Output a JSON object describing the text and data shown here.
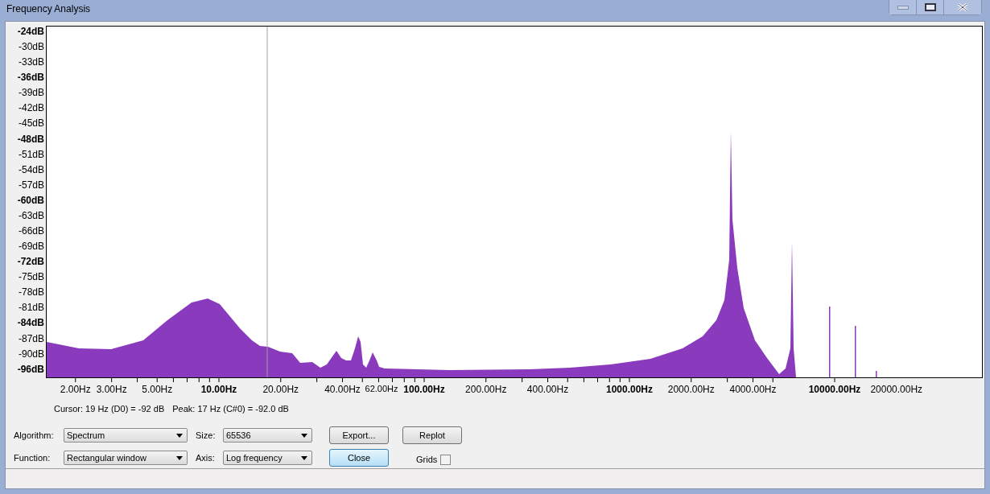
{
  "window": {
    "title": "Frequency Analysis"
  },
  "y_axis": [
    {
      "label": "-24dB",
      "bold": true
    },
    {
      "label": "-30dB",
      "bold": false
    },
    {
      "label": "-33dB",
      "bold": false
    },
    {
      "label": "-36dB",
      "bold": true
    },
    {
      "label": "-39dB",
      "bold": false
    },
    {
      "label": "-42dB",
      "bold": false
    },
    {
      "label": "-45dB",
      "bold": false
    },
    {
      "label": "-48dB",
      "bold": true
    },
    {
      "label": "-51dB",
      "bold": false
    },
    {
      "label": "-54dB",
      "bold": false
    },
    {
      "label": "-57dB",
      "bold": false
    },
    {
      "label": "-60dB",
      "bold": true
    },
    {
      "label": "-63dB",
      "bold": false
    },
    {
      "label": "-66dB",
      "bold": false
    },
    {
      "label": "-69dB",
      "bold": false
    },
    {
      "label": "-72dB",
      "bold": true
    },
    {
      "label": "-75dB",
      "bold": false
    },
    {
      "label": "-78dB",
      "bold": false
    },
    {
      "label": "-81dB",
      "bold": false
    },
    {
      "label": "-84dB",
      "bold": true
    },
    {
      "label": "-87dB",
      "bold": false
    },
    {
      "label": "-90dB",
      "bold": false
    },
    {
      "label": "-96dB",
      "bold": true
    }
  ],
  "x_axis": [
    {
      "label": "2.00Hz",
      "bold": false
    },
    {
      "label": "3.00Hz",
      "bold": false
    },
    {
      "label": "5.00Hz",
      "bold": false
    },
    {
      "label": "10.00Hz",
      "bold": true
    },
    {
      "label": "20.00Hz",
      "bold": false
    },
    {
      "label": "40.00Hz",
      "bold": false
    },
    {
      "label": "62.00Hz",
      "bold": false
    },
    {
      "label": "100.00Hz",
      "bold": true
    },
    {
      "label": "200.00Hz",
      "bold": false
    },
    {
      "label": "400.00Hz",
      "bold": false
    },
    {
      "label": "1000.00Hz",
      "bold": true
    },
    {
      "label": "2000.00Hz",
      "bold": false
    },
    {
      "label": "4000.00Hz",
      "bold": false
    },
    {
      "label": "10000.00Hz",
      "bold": true
    },
    {
      "label": "20000.00Hz",
      "bold": false
    }
  ],
  "info": {
    "cursor": "Cursor: 19 Hz (D0) = -92 dB",
    "peak": "Peak: 17 Hz (C#0) = -92.0 dB"
  },
  "controls": {
    "algorithm": {
      "label": "Algorithm:",
      "value": "Spectrum"
    },
    "size": {
      "label": "Size:",
      "value": "65536"
    },
    "function": {
      "label": "Function:",
      "value": "Rectangular window"
    },
    "axis": {
      "label": "Axis:",
      "value": "Log frequency"
    }
  },
  "buttons": [
    {
      "label": "Export...",
      "default": false
    },
    {
      "label": "Replot",
      "default": false
    },
    {
      "label": "Close",
      "default": true
    }
  ],
  "grids": {
    "label": "Grids",
    "checked": false
  }
}
